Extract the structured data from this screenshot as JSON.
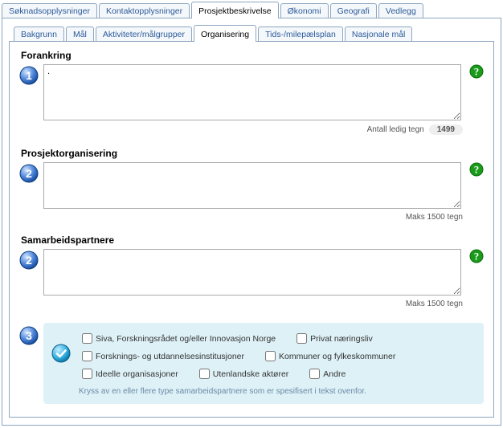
{
  "outerTabs": {
    "soknad": "Søknadsopplysninger",
    "kontakt": "Kontaktopplysninger",
    "prosjekt": "Prosjektbeskrivelse",
    "okonomi": "Økonomi",
    "geografi": "Geografi",
    "vedlegg": "Vedlegg"
  },
  "innerTabs": {
    "bakgrunn": "Bakgrunn",
    "mal": "Mål",
    "aktiviteter": "Aktiviteter/målgrupper",
    "organisering": "Organisering",
    "tids": "Tids-/milepælsplan",
    "nasjonale": "Nasjonale mål"
  },
  "sections": {
    "forankring": {
      "title": "Forankring",
      "value": ".",
      "counterLabel": "Antall ledig tegn",
      "counterValue": "1499"
    },
    "prosjektorg": {
      "title": "Prosjektorganisering",
      "value": "",
      "counterLabel": "Maks 1500 tegn"
    },
    "samarbeid": {
      "title": "Samarbeidspartnere",
      "value": "",
      "counterLabel": "Maks 1500 tegn"
    }
  },
  "checkboxes": {
    "c1": "Siva, Forskningsrådet og/eller Innovasjon Norge",
    "c2": "Privat næringsliv",
    "c3": "Forsknings- og utdannelsesinstitusjoner",
    "c4": "Kommuner og fylkeskommuner",
    "c5": "Ideelle organisasjoner",
    "c6": "Utenlandske aktører",
    "c7": "Andre",
    "hint": "Kryss av en eller flere type samarbeidspartnere som er spesifisert i tekst ovenfor."
  }
}
